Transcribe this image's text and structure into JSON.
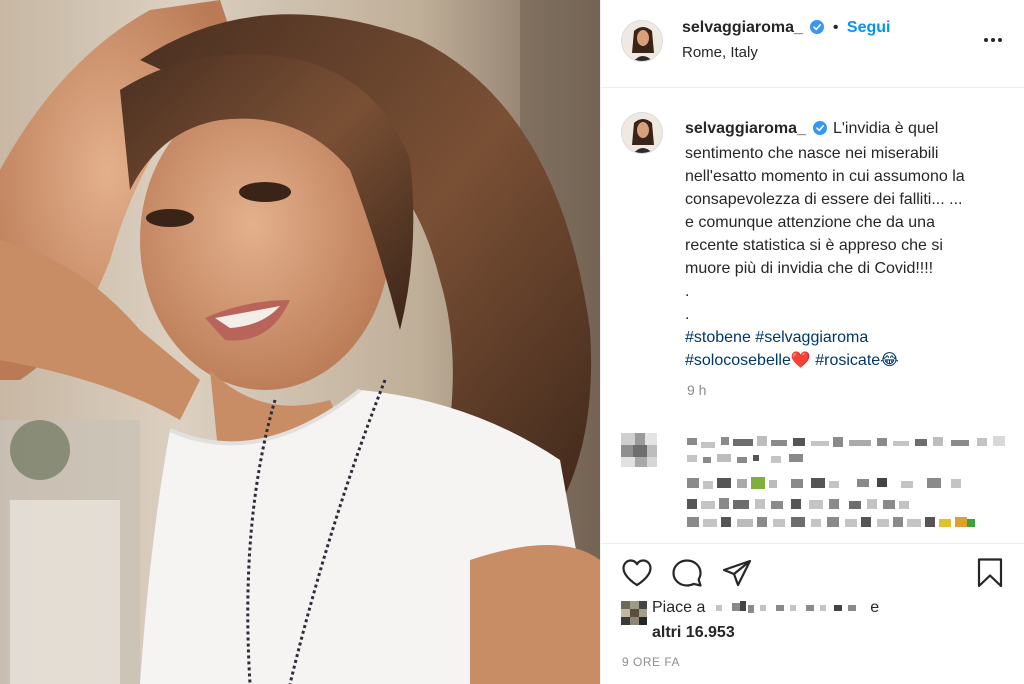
{
  "post": {
    "image_alt": "selfie photo",
    "author": {
      "username": "selvaggiaroma_",
      "location": "Rome, Italy",
      "follow_label": "Segui",
      "separator": "•"
    },
    "caption": {
      "text_lines": [
        "L'invidia è quel",
        "sentimento che nasce nei miserabili",
        "nell'esatto momento in cui assumono la",
        "consapevolezza di essere dei falliti... ...",
        "e comunque attenzione che da una",
        "recente statistica si è appreso che si",
        "muore più di invidia che di Covid!!!!",
        ".",
        "."
      ],
      "hashtags": [
        "#stobene",
        "#selvaggiaroma",
        "#solocosebelle❤️",
        "#rosicate😂"
      ],
      "time": "9 h"
    },
    "likes": {
      "prefix": "Piace a",
      "suffix": "e",
      "count": "altri 16.953"
    },
    "posted_ago": "9 ORE FA"
  },
  "colors": {
    "accent": "#0095f6",
    "text": "#262626",
    "muted": "#8e8e8e",
    "hashtag": "#00376b",
    "border": "#efefef"
  },
  "icons": {
    "header": [
      "verified-badge-icon",
      "more-options-icon"
    ],
    "actions": [
      "like-heart-icon",
      "comment-bubble-icon",
      "share-paper-plane-icon",
      "save-bookmark-icon"
    ]
  }
}
